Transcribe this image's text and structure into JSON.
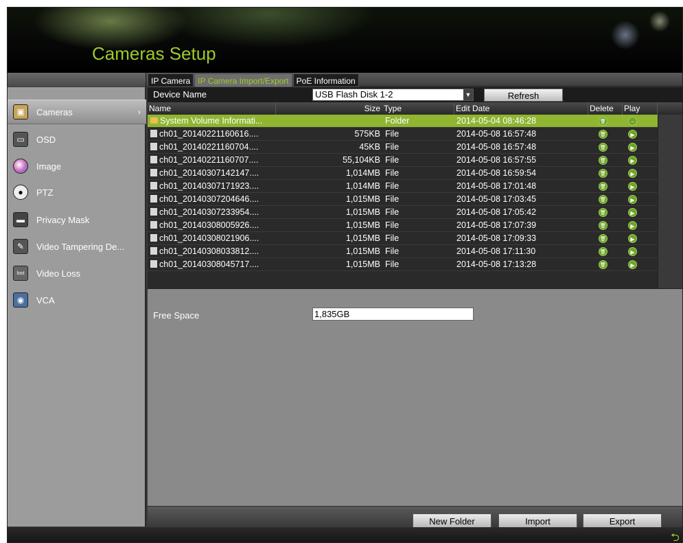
{
  "app": {
    "title": "Cameras Setup"
  },
  "tabs": [
    {
      "label": "IP Camera",
      "active": false
    },
    {
      "label": "IP Camera Import/Export",
      "active": true
    },
    {
      "label": "PoE Information",
      "active": false
    }
  ],
  "sidebar": {
    "items": [
      {
        "label": "Cameras",
        "icon": "camera-icon",
        "active": true
      },
      {
        "label": "OSD",
        "icon": "osd-icon",
        "active": false
      },
      {
        "label": "Image",
        "icon": "image-icon",
        "active": false
      },
      {
        "label": "PTZ",
        "icon": "ptz-icon",
        "active": false
      },
      {
        "label": "Privacy Mask",
        "icon": "privacy-mask-icon",
        "active": false
      },
      {
        "label": "Video Tampering De...",
        "icon": "video-tampering-icon",
        "active": false
      },
      {
        "label": "Video Loss",
        "icon": "video-loss-icon",
        "active": false
      },
      {
        "label": "VCA",
        "icon": "vca-icon",
        "active": false
      }
    ]
  },
  "device": {
    "label": "Device Name",
    "value": "USB Flash Disk 1-2",
    "refresh_label": "Refresh"
  },
  "table": {
    "headers": {
      "name": "Name",
      "size": "Size",
      "type": "Type",
      "edit_date": "Edit Date",
      "delete": "Delete",
      "play": "Play"
    },
    "rows": [
      {
        "name": "System Volume Informati...",
        "size": "",
        "type": "Folder",
        "date": "2014-05-04 08:46:28",
        "kind": "folder"
      },
      {
        "name": "ch01_20140221160616....",
        "size": "575KB",
        "type": "File",
        "date": "2014-05-08 16:57:48",
        "kind": "file"
      },
      {
        "name": "ch01_20140221160704....",
        "size": "45KB",
        "type": "File",
        "date": "2014-05-08 16:57:48",
        "kind": "file"
      },
      {
        "name": "ch01_20140221160707....",
        "size": "55,104KB",
        "type": "File",
        "date": "2014-05-08 16:57:55",
        "kind": "file"
      },
      {
        "name": "ch01_20140307142147....",
        "size": "1,014MB",
        "type": "File",
        "date": "2014-05-08 16:59:54",
        "kind": "file"
      },
      {
        "name": "ch01_20140307171923....",
        "size": "1,014MB",
        "type": "File",
        "date": "2014-05-08 17:01:48",
        "kind": "file"
      },
      {
        "name": "ch01_20140307204646....",
        "size": "1,015MB",
        "type": "File",
        "date": "2014-05-08 17:03:45",
        "kind": "file"
      },
      {
        "name": "ch01_20140307233954....",
        "size": "1,015MB",
        "type": "File",
        "date": "2014-05-08 17:05:42",
        "kind": "file"
      },
      {
        "name": "ch01_20140308005926....",
        "size": "1,015MB",
        "type": "File",
        "date": "2014-05-08 17:07:39",
        "kind": "file"
      },
      {
        "name": "ch01_20140308021906....",
        "size": "1,015MB",
        "type": "File",
        "date": "2014-05-08 17:09:33",
        "kind": "file"
      },
      {
        "name": "ch01_20140308033812....",
        "size": "1,015MB",
        "type": "File",
        "date": "2014-05-08 17:11:30",
        "kind": "file"
      },
      {
        "name": "ch01_20140308045717....",
        "size": "1,015MB",
        "type": "File",
        "date": "2014-05-08 17:13:28",
        "kind": "file"
      }
    ]
  },
  "free_space": {
    "label": "Free Space",
    "value": "1,835GB"
  },
  "buttons": {
    "new_folder": "New Folder",
    "import": "Import",
    "export": "Export"
  },
  "colors": {
    "accent": "#9ecb2b",
    "selected_row": "#8fb531"
  }
}
